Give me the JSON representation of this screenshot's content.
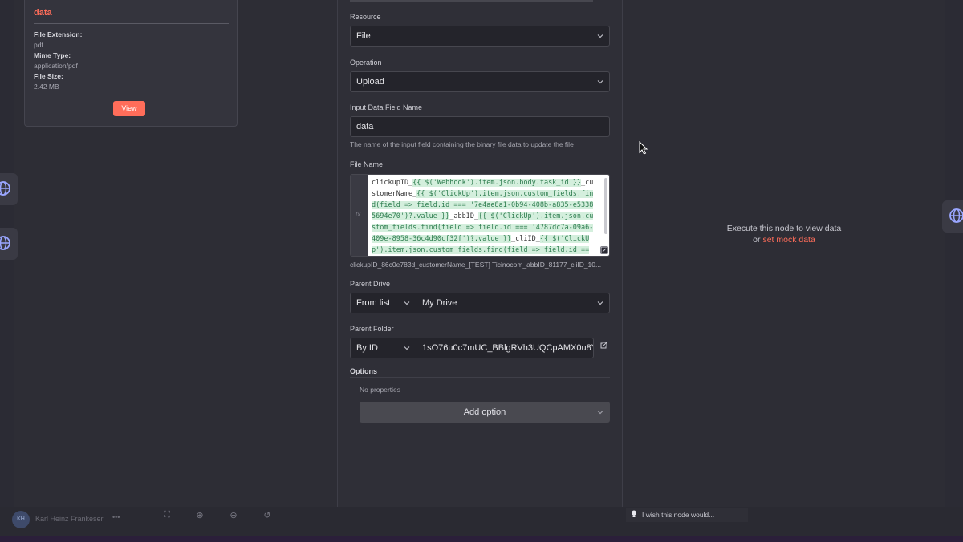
{
  "binary": {
    "title": "data",
    "file_extension_label": "File Extension:",
    "file_extension": "pdf",
    "mime_type_label": "Mime Type:",
    "mime_type": "application/pdf",
    "file_size_label": "File Size:",
    "file_size": "2.42 MB",
    "view_label": "View"
  },
  "params": {
    "resource_label": "Resource",
    "resource_value": "File",
    "operation_label": "Operation",
    "operation_value": "Upload",
    "input_field_label": "Input Data Field Name",
    "input_field_value": "data",
    "input_field_hint": "The name of the input field containing the binary file data to update the file",
    "file_name_label": "File Name",
    "file_name_fx": "fx",
    "file_name_expr_1": "clickupID_",
    "file_name_expr_2": "{{ $('Webhook').item.json.body.task_id }}",
    "file_name_expr_3": "_customerName_",
    "file_name_expr_4": "{{ $('ClickUp').item.json.custom_fields.find(field => field.id === '7e4ae8a1-0b94-408b-a835-e53385694e70')?.value }}",
    "file_name_expr_5": "_abbID_",
    "file_name_expr_6": "{{ $('ClickUp').item.json.custom_fields.find(field => field.id === '4787dc7a-09a6-409e-8958-36c4d90cf32f')?.value }}",
    "file_name_expr_7": "_cliID_",
    "file_name_expr_8": "{{ $('ClickUp').item.json.custom_fields.find(field => field.id ==",
    "file_name_preview": "clickupID_86c0e783d_customerName_[TEST] Ticinocom_abbID_81177_cliID_10...",
    "parent_drive_label": "Parent Drive",
    "parent_drive_mode": "From list",
    "parent_drive_value": "My Drive",
    "parent_folder_label": "Parent Folder",
    "parent_folder_mode": "By ID",
    "parent_folder_value": "1sO76u0c7mUC_BBlgRVh3UQCpAMX0u8Y-",
    "options_label": "Options",
    "no_properties": "No properties",
    "add_option_label": "Add option"
  },
  "output": {
    "execute_text": "Execute this node to view data",
    "or_text": "or ",
    "mock_link": "set mock data"
  },
  "footer": {
    "avatar_initials": "KH",
    "username": "Karl Heinz Frankeser",
    "more": "•••",
    "feedback": "I wish this node would..."
  },
  "colors": {
    "accent": "#ff6d5a",
    "panel": "#2f2f37",
    "input_bg": "#24242b"
  }
}
